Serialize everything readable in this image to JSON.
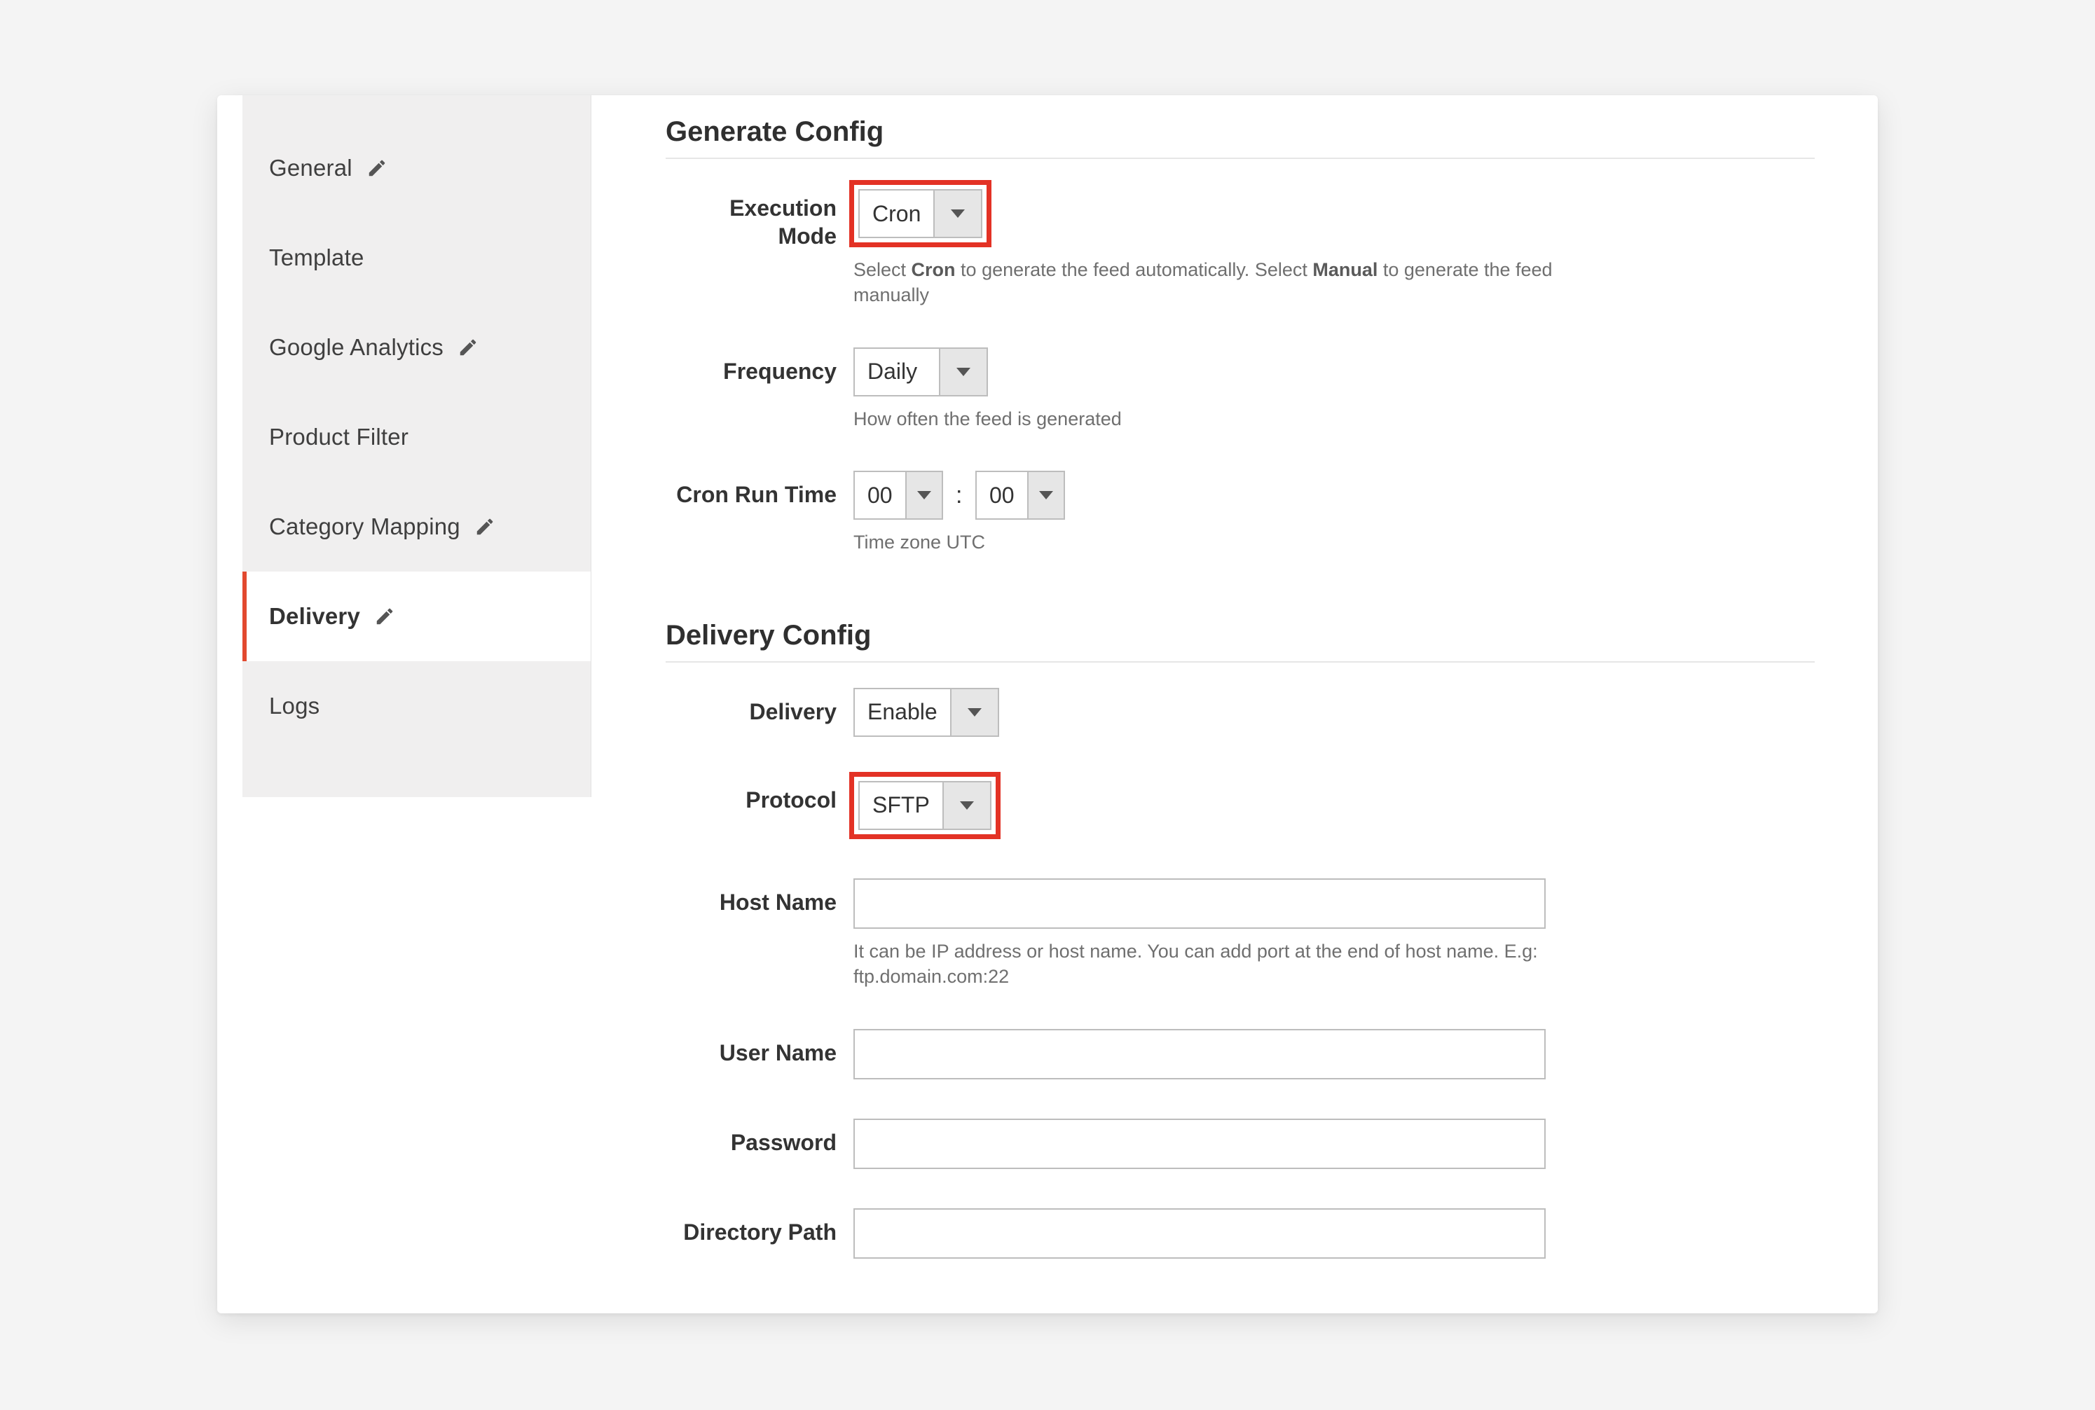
{
  "sidebar": {
    "items": [
      {
        "label": "General",
        "editable": true
      },
      {
        "label": "Template",
        "editable": false
      },
      {
        "label": "Google Analytics",
        "editable": true
      },
      {
        "label": "Product Filter",
        "editable": false
      },
      {
        "label": "Category Mapping",
        "editable": true
      },
      {
        "label": "Delivery",
        "editable": true,
        "active": true
      },
      {
        "label": "Logs",
        "editable": false
      }
    ]
  },
  "sections": {
    "generate": {
      "heading": "Generate Config",
      "execution_mode": {
        "label": "Execution Mode",
        "value": "Cron",
        "hint_prefix": "Select ",
        "hint_bold1": "Cron",
        "hint_mid": " to generate the feed automatically. Select ",
        "hint_bold2": "Manual",
        "hint_suffix": " to generate the feed manually"
      },
      "frequency": {
        "label": "Frequency",
        "value": "Daily",
        "hint": "How often the feed is generated"
      },
      "cron_run_time": {
        "label": "Cron Run Time",
        "hour": "00",
        "minute": "00",
        "hint": "Time zone UTC"
      }
    },
    "delivery": {
      "heading": "Delivery Config",
      "delivery": {
        "label": "Delivery",
        "value": "Enable"
      },
      "protocol": {
        "label": "Protocol",
        "value": "SFTP"
      },
      "host": {
        "label": "Host Name",
        "value": "",
        "hint": "It can be IP address or host name. You can add port at the end of host name. E.g: ftp.domain.com:22"
      },
      "user": {
        "label": "User Name",
        "value": ""
      },
      "password": {
        "label": "Password",
        "value": ""
      },
      "directory": {
        "label": "Directory Path",
        "value": ""
      }
    }
  }
}
